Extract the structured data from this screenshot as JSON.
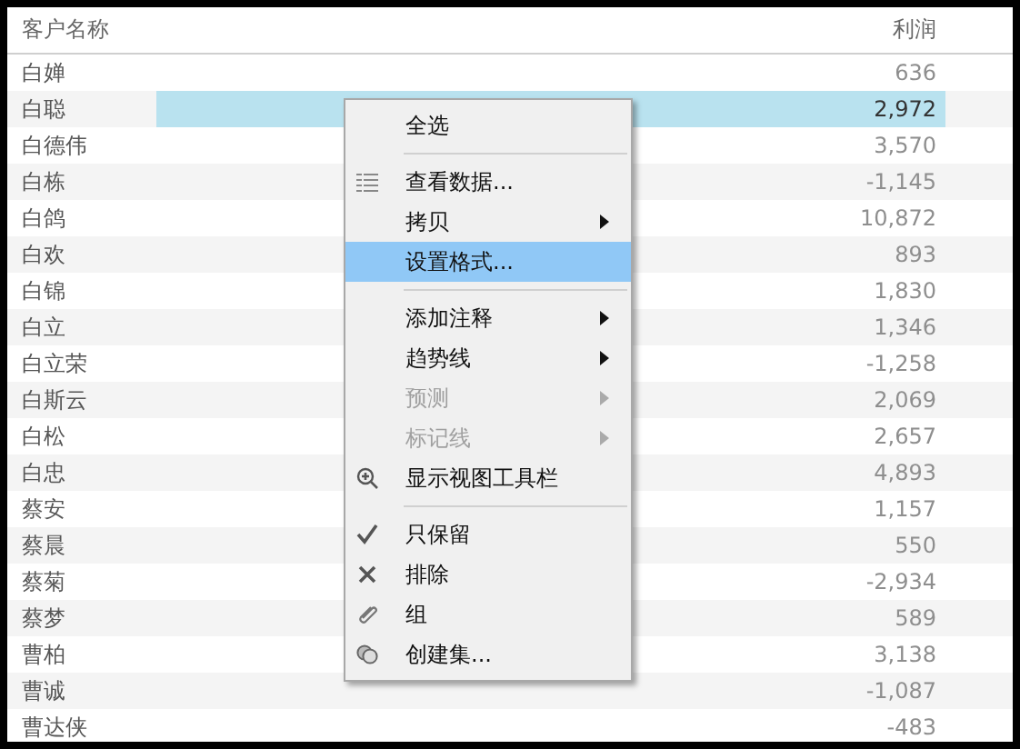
{
  "table": {
    "columns": [
      "客户名称",
      "利润"
    ],
    "rows": [
      {
        "name": "白婵",
        "profit": "636",
        "selected": false
      },
      {
        "name": "白聪",
        "profit": "2,972",
        "selected": true
      },
      {
        "name": "白德伟",
        "profit": "3,570",
        "selected": false
      },
      {
        "name": "白栋",
        "profit": "-1,145",
        "selected": false
      },
      {
        "name": "白鸽",
        "profit": "10,872",
        "selected": false
      },
      {
        "name": "白欢",
        "profit": "893",
        "selected": false
      },
      {
        "name": "白锦",
        "profit": "1,830",
        "selected": false
      },
      {
        "name": "白立",
        "profit": "1,346",
        "selected": false
      },
      {
        "name": "白立荣",
        "profit": "-1,258",
        "selected": false
      },
      {
        "name": "白斯云",
        "profit": "2,069",
        "selected": false
      },
      {
        "name": "白松",
        "profit": "2,657",
        "selected": false
      },
      {
        "name": "白忠",
        "profit": "4,893",
        "selected": false
      },
      {
        "name": "蔡安",
        "profit": "1,157",
        "selected": false
      },
      {
        "name": "蔡晨",
        "profit": "550",
        "selected": false
      },
      {
        "name": "蔡菊",
        "profit": "-2,934",
        "selected": false
      },
      {
        "name": "蔡梦",
        "profit": "589",
        "selected": false
      },
      {
        "name": "曹柏",
        "profit": "3,138",
        "selected": false
      },
      {
        "name": "曹诚",
        "profit": "-1,087",
        "selected": false
      },
      {
        "name": "曹达侠",
        "profit": "-483",
        "selected": false
      }
    ]
  },
  "context_menu": {
    "items": [
      {
        "kind": "plain",
        "label": "全选",
        "submenu": false,
        "disabled": false,
        "selected": false
      },
      {
        "kind": "separator"
      },
      {
        "kind": "view-data",
        "label": "查看数据...",
        "submenu": false,
        "disabled": false,
        "selected": false
      },
      {
        "kind": "plain",
        "label": "拷贝",
        "submenu": true,
        "disabled": false,
        "selected": false
      },
      {
        "kind": "plain",
        "label": "设置格式...",
        "submenu": false,
        "disabled": false,
        "selected": true
      },
      {
        "kind": "separator"
      },
      {
        "kind": "plain",
        "label": "添加注释",
        "submenu": true,
        "disabled": false,
        "selected": false
      },
      {
        "kind": "plain",
        "label": "趋势线",
        "submenu": true,
        "disabled": false,
        "selected": false
      },
      {
        "kind": "plain",
        "label": "预测",
        "submenu": true,
        "disabled": true,
        "selected": false
      },
      {
        "kind": "plain",
        "label": "标记线",
        "submenu": true,
        "disabled": true,
        "selected": false
      },
      {
        "kind": "show-toolbar",
        "label": "显示视图工具栏",
        "submenu": false,
        "disabled": false,
        "selected": false
      },
      {
        "kind": "separator"
      },
      {
        "kind": "keep",
        "label": "只保留",
        "submenu": false,
        "disabled": false,
        "selected": false
      },
      {
        "kind": "exclude",
        "label": "排除",
        "submenu": false,
        "disabled": false,
        "selected": false
      },
      {
        "kind": "group",
        "label": "组",
        "submenu": false,
        "disabled": false,
        "selected": false
      },
      {
        "kind": "create-set",
        "label": "创建集...",
        "submenu": false,
        "disabled": false,
        "selected": false
      }
    ]
  }
}
